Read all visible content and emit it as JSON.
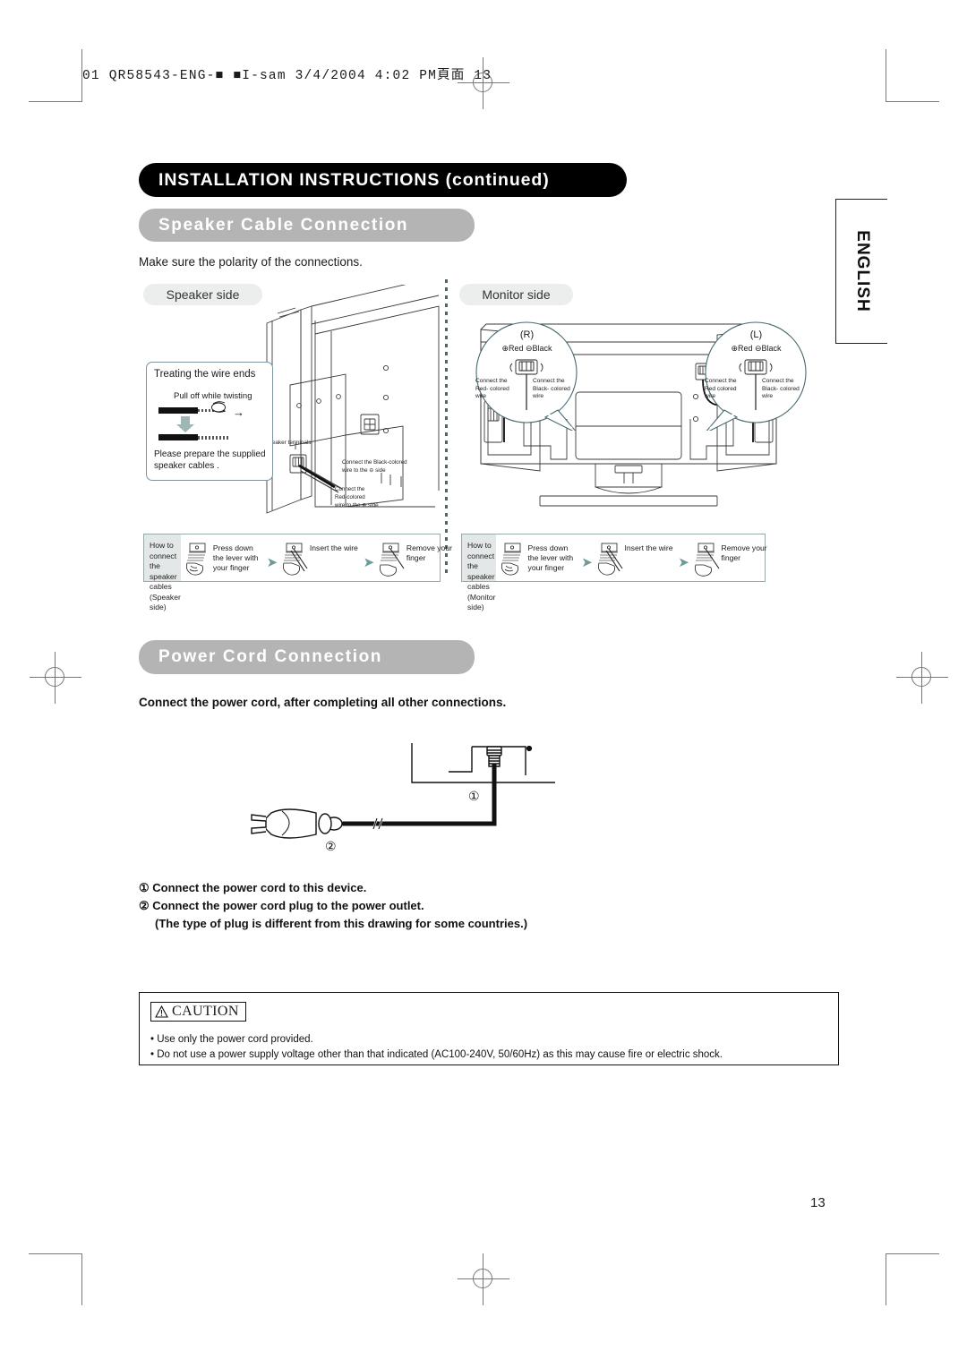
{
  "print_slug": {
    "prefix": "01 QR58543-ENG-",
    "middle": "I-sam",
    "date": "3/4/2004",
    "time": "4:02 PM",
    "page_marker": "頁面",
    "page_num": "13",
    "full": "01 QR58543-ENG-■ ■I-sam 3/4/2004 4:02 PM頁面 13"
  },
  "header": {
    "title": "INSTALLATION INSTRUCTIONS (continued)",
    "accent_black": "#000000",
    "accent_gray": "#b4b4b4"
  },
  "speaker_section": {
    "bar_label": "Speaker Cable Connection",
    "lead": "Make sure the polarity of the connections.",
    "speaker_pill": "Speaker side",
    "monitor_pill": "Monitor side",
    "wire_box": {
      "title": "Treating the wire ends",
      "subtitle": "Pull off while twisting",
      "footer": "Please prepare the supplied speaker cables  ."
    },
    "speaker_diagram": {
      "terminals_label": "Speaker terminals",
      "black_note": "Connect the Black-colored wire to the ⊖ side",
      "red_note": "Connect the Red-colored wire to the ⊕ side"
    },
    "monitor_diagram": {
      "right_callout": {
        "channel": "(R)",
        "polarity": "⊕Red  ⊖Black",
        "left_text": "Connect the Red- colored wire",
        "right_text": "Connect the Black- colored wire"
      },
      "left_callout": {
        "channel": "(L)",
        "polarity": "⊕Red  ⊖Black",
        "left_text": "Connect the Red colored wire",
        "right_text": "Connect the Black- colored wire"
      }
    },
    "howto_speaker": {
      "label": "How to connect the speaker cables (Speaker side)",
      "steps": [
        "Press down the lever with your finger",
        "Insert the wire",
        "Remove your finger"
      ]
    },
    "howto_monitor": {
      "label": "How to connect the speaker cables (Monitor side)",
      "steps": [
        "Press down the lever with your finger",
        "Insert the wire",
        "Remove your finger"
      ]
    }
  },
  "power_section": {
    "bar_label": "Power Cord Connection",
    "note": "Connect the power cord, after completing all other connections.",
    "diagram": {
      "marker_one": "①",
      "marker_two": "②"
    },
    "steps": [
      "① Connect the power cord to this device.",
      "② Connect the power cord plug to the power outlet.",
      "(The type of plug is different from this drawing for some countries.)"
    ]
  },
  "caution": {
    "tag": "CAUTION",
    "warning_icon": "warning-triangle",
    "lines": [
      "• Use only the power cord provided.",
      "• Do not use a power supply voltage other than that indicated (AC100-240V, 50/60Hz) as this may cause fire or electric shock."
    ]
  },
  "sidebar": {
    "language_tab": "ENGLISH"
  },
  "footer": {
    "page_number": "13"
  }
}
